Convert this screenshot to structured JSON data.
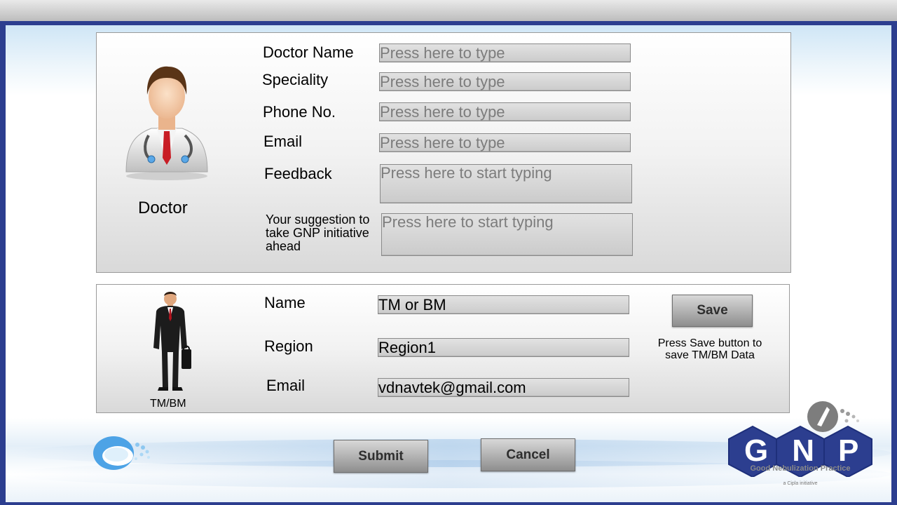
{
  "doctor": {
    "caption": "Doctor",
    "fields": [
      {
        "label": "Doctor Name",
        "placeholder": "Press here to type",
        "value": ""
      },
      {
        "label": "Speciality",
        "placeholder": "Press here to type",
        "value": ""
      },
      {
        "label": "Phone No.",
        "placeholder": "Press here to type",
        "value": ""
      },
      {
        "label": "Email",
        "placeholder": "Press here to type",
        "value": ""
      },
      {
        "label": "Feedback",
        "placeholder": "Press here to start typing",
        "value": ""
      },
      {
        "label": "Your suggestion to take GNP initiative ahead",
        "placeholder": "Press here to start typing",
        "value": ""
      }
    ]
  },
  "tmbm": {
    "caption": "TM/BM",
    "fields": [
      {
        "label": "Name",
        "value": "TM or BM"
      },
      {
        "label": "Region",
        "value": "Region1"
      },
      {
        "label": "Email",
        "value": "vdnavtek@gmail.com"
      }
    ],
    "save_label": "Save",
    "save_hint": "Press Save button to save TM/BM Data"
  },
  "actions": {
    "submit_label": "Submit",
    "cancel_label": "Cancel"
  },
  "brand": {
    "logo_letters": "GNP",
    "tagline": "Good Nebulization Practice",
    "subline": "a Cipla initiative",
    "blue": "#2c3e8f",
    "dark_blue": "#1e2f7a",
    "light_blue": "#4da3e6",
    "grey": "#7d7d7d"
  }
}
